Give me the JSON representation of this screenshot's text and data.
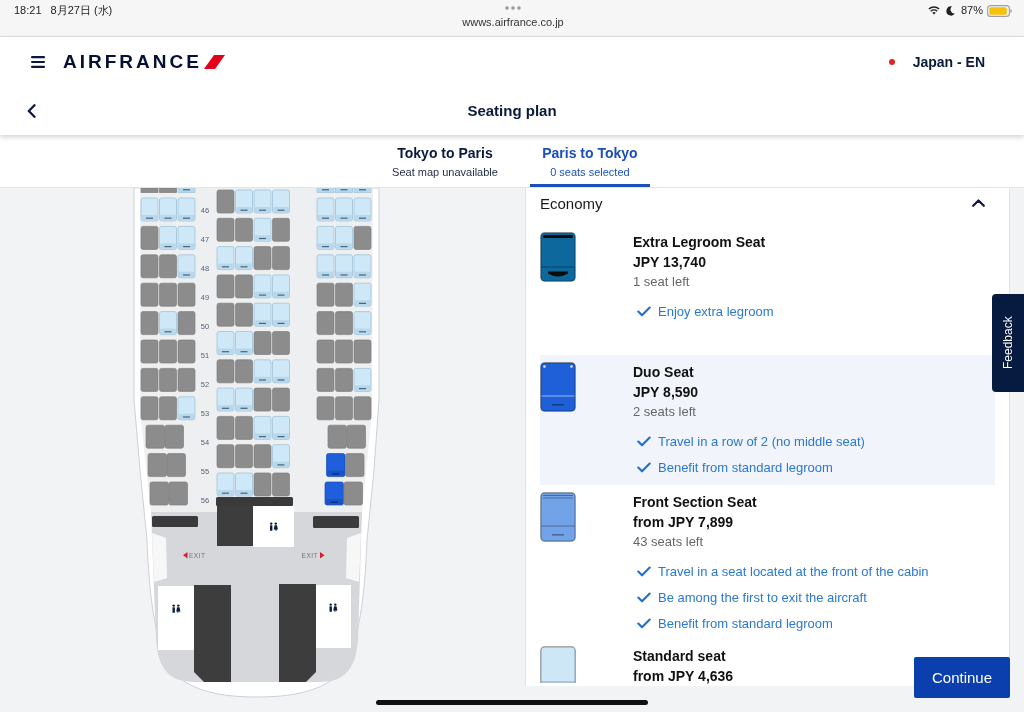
{
  "status_bar": {
    "time": "18:21",
    "date": "8月27日 (水)",
    "url": "wwws.airfrance.co.jp",
    "battery": "87%"
  },
  "header": {
    "logo": "AIRFRANCE",
    "locale": "Japan - EN",
    "title": "Seating plan"
  },
  "tabs": [
    {
      "title": "Tokyo to Paris",
      "subtitle": "Seat map unavailable",
      "selected": false
    },
    {
      "title": "Paris to Tokyo",
      "subtitle": "0 seats selected",
      "selected": true
    }
  ],
  "seat_map": {
    "rows": [
      {
        "left": [
          {
            "kind": "taken"
          },
          {
            "kind": "taken"
          },
          {
            "kind": "free"
          }
        ],
        "right": [
          {
            "kind": "free"
          },
          {
            "kind": "free"
          },
          {
            "kind": "free"
          }
        ]
      },
      {
        "number": "46",
        "left": [
          {
            "kind": "free"
          },
          {
            "kind": "free"
          },
          {
            "kind": "free"
          }
        ],
        "center": [
          {
            "kind": "taken"
          },
          {
            "kind": "free"
          },
          {
            "kind": "free"
          },
          {
            "kind": "free"
          }
        ],
        "right": [
          {
            "kind": "free"
          },
          {
            "kind": "free"
          },
          {
            "kind": "free"
          }
        ]
      },
      {
        "number": "47",
        "left": [
          {
            "kind": "taken"
          },
          {
            "kind": "free"
          },
          {
            "kind": "free"
          }
        ],
        "center": [
          {
            "kind": "taken"
          },
          {
            "kind": "taken"
          },
          {
            "kind": "free"
          },
          {
            "kind": "taken"
          }
        ],
        "right": [
          {
            "kind": "free"
          },
          {
            "kind": "free"
          },
          {
            "kind": "taken"
          }
        ]
      },
      {
        "number": "48",
        "left": [
          {
            "kind": "taken"
          },
          {
            "kind": "taken"
          },
          {
            "kind": "free"
          }
        ],
        "center": [
          {
            "kind": "free"
          },
          {
            "kind": "free"
          },
          {
            "kind": "taken"
          },
          {
            "kind": "taken"
          }
        ],
        "right": [
          {
            "kind": "free"
          },
          {
            "kind": "free"
          },
          {
            "kind": "free"
          }
        ]
      },
      {
        "number": "49",
        "left": [
          {
            "kind": "taken"
          },
          {
            "kind": "taken"
          },
          {
            "kind": "taken"
          }
        ],
        "center": [
          {
            "kind": "taken"
          },
          {
            "kind": "taken"
          },
          {
            "kind": "free"
          },
          {
            "kind": "free"
          }
        ],
        "right": [
          {
            "kind": "taken"
          },
          {
            "kind": "taken"
          },
          {
            "kind": "free"
          }
        ]
      },
      {
        "number": "50",
        "left": [
          {
            "kind": "taken"
          },
          {
            "kind": "free"
          },
          {
            "kind": "taken"
          }
        ],
        "center": [
          {
            "kind": "taken"
          },
          {
            "kind": "taken"
          },
          {
            "kind": "free"
          },
          {
            "kind": "free"
          }
        ],
        "right": [
          {
            "kind": "taken"
          },
          {
            "kind": "taken"
          },
          {
            "kind": "free"
          }
        ]
      },
      {
        "number": "51",
        "left": [
          {
            "kind": "taken"
          },
          {
            "kind": "taken"
          },
          {
            "kind": "taken"
          }
        ],
        "center": [
          {
            "kind": "free"
          },
          {
            "kind": "free"
          },
          {
            "kind": "taken"
          },
          {
            "kind": "taken"
          }
        ],
        "right": [
          {
            "kind": "taken"
          },
          {
            "kind": "taken"
          },
          {
            "kind": "taken"
          }
        ]
      },
      {
        "number": "52",
        "left": [
          {
            "kind": "taken"
          },
          {
            "kind": "taken"
          },
          {
            "kind": "taken"
          }
        ],
        "center": [
          {
            "kind": "taken"
          },
          {
            "kind": "taken"
          },
          {
            "kind": "free"
          },
          {
            "kind": "free"
          }
        ],
        "right": [
          {
            "kind": "taken"
          },
          {
            "kind": "taken"
          },
          {
            "kind": "free"
          }
        ]
      },
      {
        "number": "53",
        "left": [
          {
            "kind": "taken"
          },
          {
            "kind": "taken"
          },
          {
            "kind": "free"
          }
        ],
        "center": [
          {
            "kind": "free"
          },
          {
            "kind": "free"
          },
          {
            "kind": "taken"
          },
          {
            "kind": "taken"
          }
        ],
        "right": [
          {
            "kind": "taken"
          },
          {
            "kind": "taken"
          },
          {
            "kind": "taken"
          }
        ]
      },
      {
        "number": "54",
        "left": [
          {
            "kind": "taken"
          },
          {
            "kind": "taken"
          }
        ],
        "center": [
          {
            "kind": "taken"
          },
          {
            "kind": "taken"
          },
          {
            "kind": "free"
          },
          {
            "kind": "free"
          }
        ],
        "right": [
          {
            "kind": "taken"
          },
          {
            "kind": "taken"
          }
        ]
      },
      {
        "number": "55",
        "left": [
          {
            "kind": "taken"
          },
          {
            "kind": "taken"
          }
        ],
        "center": [
          {
            "kind": "taken"
          },
          {
            "kind": "taken"
          },
          {
            "kind": "taken"
          },
          {
            "kind": "free"
          }
        ],
        "right": [
          {
            "kind": "duo"
          },
          {
            "kind": "taken"
          }
        ]
      },
      {
        "number": "56",
        "left": [
          {
            "kind": "taken"
          },
          {
            "kind": "taken"
          }
        ],
        "center": [
          {
            "kind": "free"
          },
          {
            "kind": "free"
          },
          {
            "kind": "taken"
          },
          {
            "kind": "taken"
          }
        ],
        "right": [
          {
            "kind": "duo"
          },
          {
            "kind": "taken"
          }
        ]
      }
    ],
    "exits": [
      "EXIT",
      "EXIT"
    ]
  },
  "cabin_panel": {
    "title": "Economy",
    "expanded": true,
    "seat_types": [
      {
        "kind": "legroom",
        "color": "#0d699d",
        "name": "Extra Legroom Seat",
        "price": "JPY 13,740",
        "availability": "1 seat left",
        "features": [
          "Enjoy extra legroom"
        ],
        "selected": false
      },
      {
        "kind": "duo",
        "color": "#1f5fd8",
        "name": "Duo Seat",
        "price": "JPY 8,590",
        "availability": "2 seats left",
        "features": [
          "Travel in a row of 2 (no middle seat)",
          "Benefit from standard legroom"
        ],
        "selected": true
      },
      {
        "kind": "front",
        "color": "#72a2e8",
        "name": "Front Section Seat",
        "price": "from JPY 7,899",
        "availability": "43 seats left",
        "features": [
          "Travel in a seat located at the front of the cabin",
          "Be among the first to exit the aircraft",
          "Benefit from standard legroom"
        ],
        "selected": false
      },
      {
        "kind": "standard",
        "color": "#cde7f7",
        "name": "Standard seat",
        "price": "from JPY 4,636",
        "selected": false
      }
    ]
  },
  "feedback_button": "Feedback",
  "continue_button": "Continue"
}
